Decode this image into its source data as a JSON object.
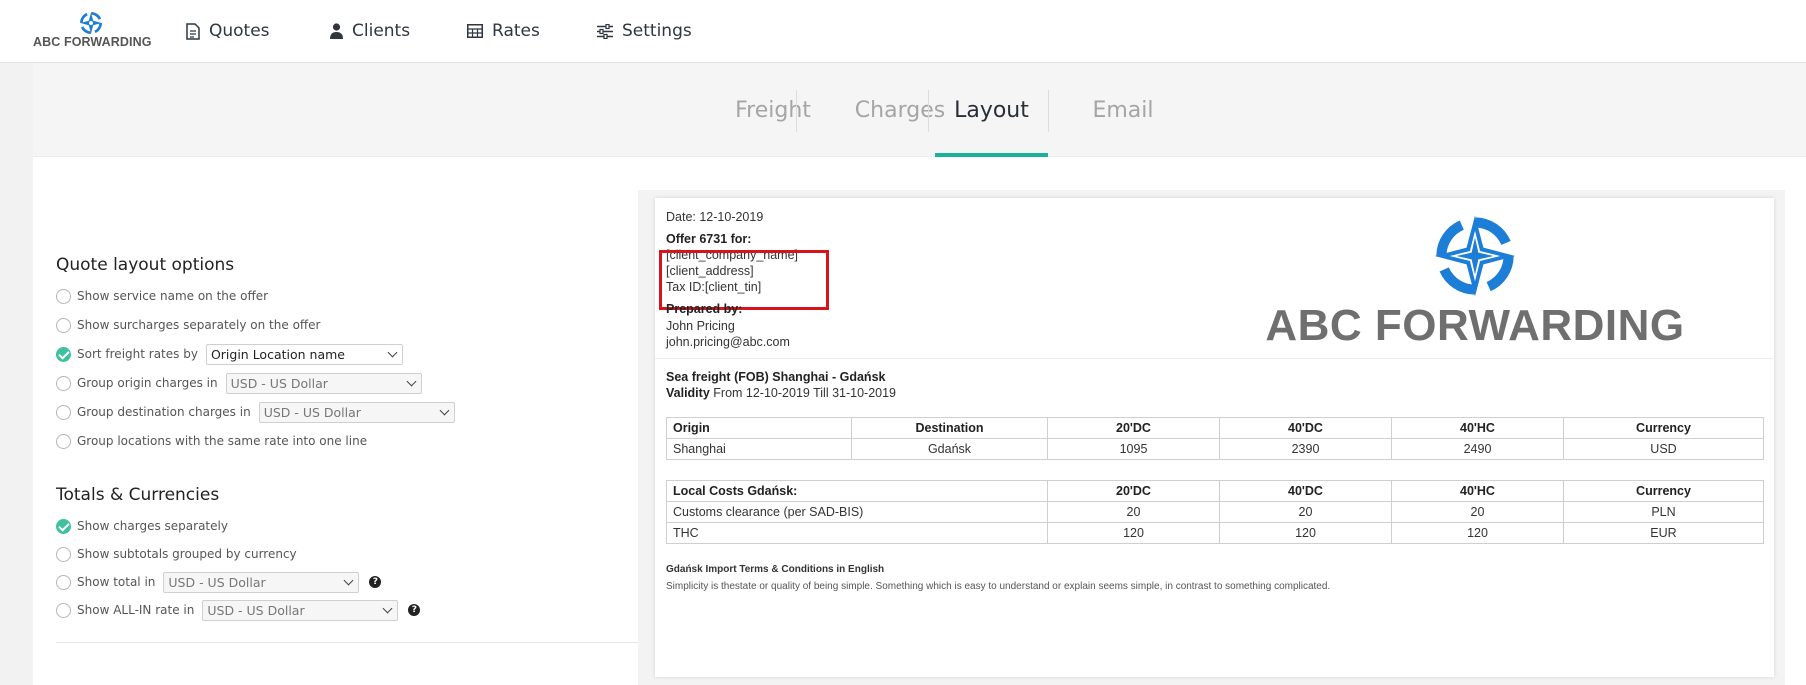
{
  "app": {
    "brand": "ABC FORWARDING",
    "accent": "#19b29b",
    "logo_color": "#1c7ed6"
  },
  "nav": {
    "items": [
      {
        "label": "Quotes",
        "icon": "document-icon"
      },
      {
        "label": "Clients",
        "icon": "user-icon"
      },
      {
        "label": "Rates",
        "icon": "table-icon"
      },
      {
        "label": "Settings",
        "icon": "sliders-icon"
      }
    ]
  },
  "tabs": {
    "items": [
      "Freight",
      "Charges",
      "Layout",
      "Email"
    ],
    "active": "Layout"
  },
  "layout_options": {
    "title": "Quote layout options",
    "show_service_name": "Show service name on the offer",
    "show_surcharges": "Show surcharges separately on the offer",
    "sort_freight": "Sort freight rates by",
    "sort_freight_value": "Origin Location name",
    "group_origin": "Group origin charges in",
    "group_origin_value": "USD - US Dollar",
    "group_destination": "Group destination charges in",
    "group_destination_value": "USD - US Dollar",
    "group_locations": "Group locations with the same rate into one line"
  },
  "totals": {
    "title": "Totals & Currencies",
    "show_separately": "Show charges separately",
    "show_subtotals": "Show subtotals grouped by currency",
    "show_total": "Show total in",
    "show_total_value": "USD - US Dollar",
    "show_allin": "Show ALL-IN rate in",
    "show_allin_value": "USD - US Dollar",
    "help": "?"
  },
  "preview": {
    "date": "Date: 12-10-2019",
    "offer_for": "Offer 6731 for:",
    "client_company": "[client_company_name]",
    "client_address": "[client_address]",
    "client_tin": "Tax ID:[client_tin]",
    "prepared_by": "Prepared by:",
    "preparer_name": "John Pricing",
    "preparer_email": "john.pricing@abc.com",
    "logo_text": "ABC FORWARDING",
    "freight_title": "Sea freight (FOB) Shanghai - Gdańsk",
    "validity_label": "Validity",
    "validity_value": "From 12-10-2019 Till 31-10-2019",
    "freight_table": {
      "headers": [
        "Origin",
        "Destination",
        "20'DC",
        "40'DC",
        "40'HC",
        "Currency"
      ],
      "rows": [
        [
          "Shanghai",
          "Gdańsk",
          "1095",
          "2390",
          "2490",
          "USD"
        ]
      ]
    },
    "local_table": {
      "headers": [
        "Local Costs Gdańsk:",
        "20'DC",
        "40'DC",
        "40'HC",
        "Currency"
      ],
      "rows": [
        [
          "Customs clearance (per SAD-BIS)",
          "20",
          "20",
          "20",
          "PLN"
        ],
        [
          "THC",
          "120",
          "120",
          "120",
          "EUR"
        ]
      ]
    },
    "terms_title": "Gdańsk Import Terms & Conditions in English",
    "terms_body": "Simplicity is thestate or quality of being simple. Something which is easy to understand or explain seems simple, in contrast to something complicated."
  }
}
